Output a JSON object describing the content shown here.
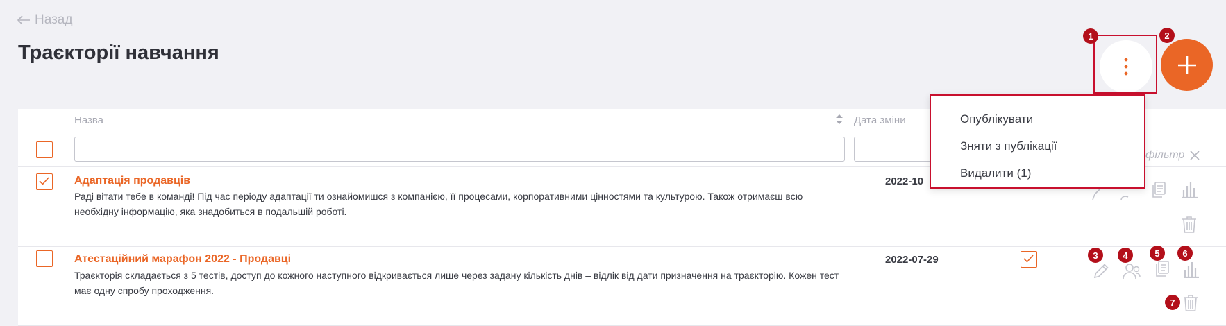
{
  "nav": {
    "back_label": "Назад"
  },
  "page": {
    "title": "Траєкторії навчання"
  },
  "table": {
    "columns": {
      "name": "Назва",
      "date": "Дата зміни"
    },
    "filter_label": "фільтр",
    "rows": [
      {
        "title": "Адаптація продавців",
        "description": "Раді вітати тебе в команді! Під час періоду адаптації ти ознайомишся з компанією, її процесами, корпоративними цінностями та культурою. Також отримаєш всю необхідну інформацію, яка знадобиться в подальшій роботі.",
        "date": "2022-10",
        "selected": true
      },
      {
        "title": "Атестаційний марафон 2022 - Продавці",
        "description": "Траєкторія складається з 5 тестів, доступ до кожного наступного відкривається лише через задану кількість днів – відлік від дати призначення на траєкторію. Кожен тест має одну спробу проходження.",
        "date": "2022-07-29",
        "selected": false,
        "published": true
      }
    ]
  },
  "menu": {
    "items": [
      "Опублікувати",
      "Зняти з публікації",
      "Видалити (1)"
    ]
  },
  "badges": [
    "1",
    "2",
    "3",
    "4",
    "5",
    "6",
    "7"
  ],
  "colors": {
    "accent": "#ea6626",
    "highlight": "#c8102e",
    "badge": "#b30f1a",
    "background": "#f1f1f5"
  },
  "icons": [
    "arrow-left-icon",
    "more-vertical-icon",
    "plus-icon",
    "sort-icon",
    "check-icon",
    "close-icon",
    "edit-icon",
    "users-icon",
    "copy-icon",
    "stats-icon",
    "trash-icon"
  ]
}
